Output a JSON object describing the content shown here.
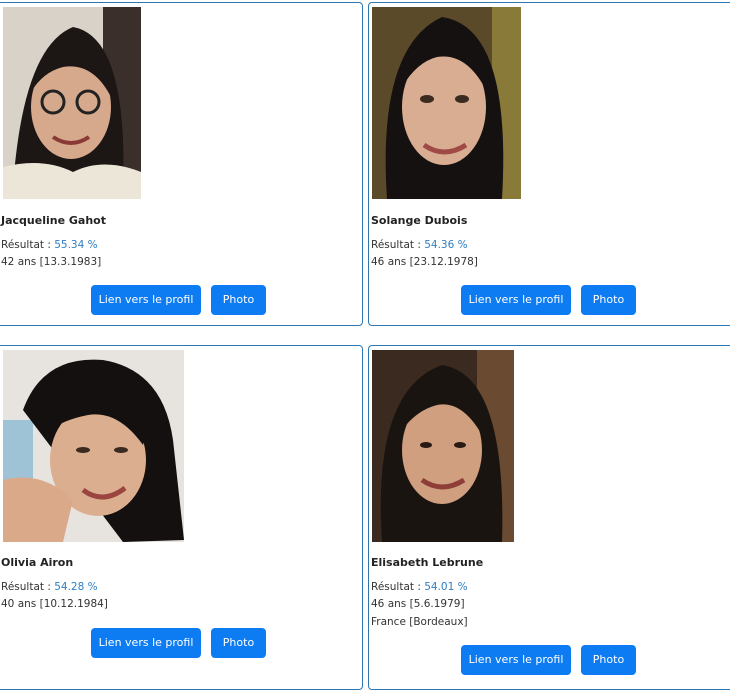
{
  "profiles": [
    {
      "name": "Jacqueline Gahot",
      "result_label": "Résultat :",
      "result_value": "55.34 %",
      "age_birth": "42 ans [13.3.1983]",
      "profile_button": "Lien vers le profil",
      "photo_button": "Photo"
    },
    {
      "name": "Solange Dubois",
      "result_label": "Résultat :",
      "result_value": "54.36 %",
      "age_birth": "46 ans [23.12.1978]",
      "profile_button": "Lien vers le profil",
      "photo_button": "Photo"
    },
    {
      "name": "Olivia Airon",
      "result_label": "Résultat :",
      "result_value": "54.28 %",
      "age_birth": "40 ans [10.12.1984]",
      "profile_button": "Lien vers le profil",
      "photo_button": "Photo"
    },
    {
      "name": "Elisabeth Lebrune",
      "result_label": "Résultat :",
      "result_value": "54.01 %",
      "age_birth": "46 ans [5.6.1979]",
      "location": "France [Bordeaux]",
      "profile_button": "Lien vers le profil",
      "photo_button": "Photo"
    }
  ],
  "colors": {
    "card_border": "#2d78b3",
    "button_bg": "#0d7cf2",
    "score_text": "#2f7ec4"
  }
}
